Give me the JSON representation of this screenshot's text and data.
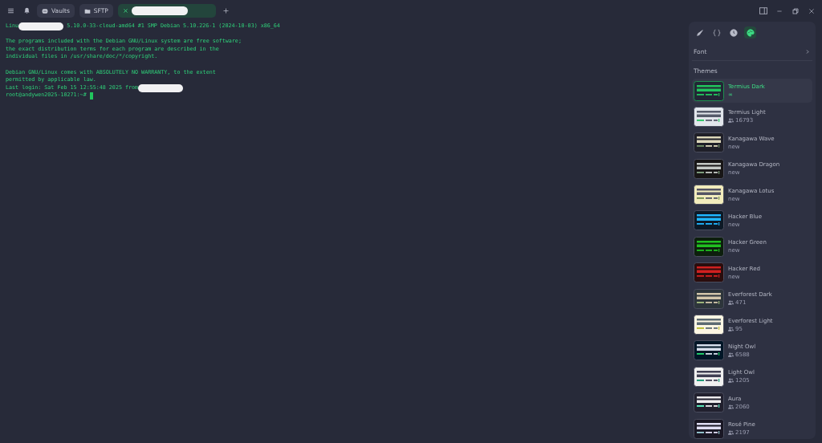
{
  "topbar": {
    "tabs": [
      {
        "label": "Vaults",
        "kind": "vault",
        "selected": false
      },
      {
        "label": "SFTP",
        "kind": "folder",
        "selected": false
      },
      {
        "kind": "session",
        "selected": true
      }
    ]
  },
  "terminal": {
    "lines": [
      {
        "parts": [
          {
            "kind": "text",
            "text": "Linu"
          },
          {
            "kind": "redaction"
          },
          {
            "kind": "text",
            "text": " 5.10.0-33-cloud-amd64 #1 SMP Debian 5.10.226-1 (2024-10-03) x86_64"
          }
        ]
      },
      {
        "kind": "blank"
      },
      {
        "parts": [
          {
            "kind": "text",
            "text": "The programs included with the Debian GNU/Linux system are free software;"
          }
        ]
      },
      {
        "parts": [
          {
            "kind": "text",
            "text": "the exact distribution terms for each program are described in the"
          }
        ]
      },
      {
        "parts": [
          {
            "kind": "text",
            "text": "individual files in /usr/share/doc/*/copyright."
          }
        ]
      },
      {
        "kind": "blank"
      },
      {
        "parts": [
          {
            "kind": "text",
            "text": "Debian GNU/Linux comes with ABSOLUTELY NO WARRANTY, to the extent"
          }
        ]
      },
      {
        "parts": [
          {
            "kind": "text",
            "text": "permitted by applicable law."
          }
        ]
      },
      {
        "parts": [
          {
            "kind": "text",
            "text": "Last login: Sat Feb 15 12:55:48 2025 from"
          },
          {
            "kind": "redaction"
          }
        ]
      },
      {
        "parts": [
          {
            "kind": "text",
            "text": "root@andywen2025-10271:~# "
          },
          {
            "kind": "cursor"
          }
        ]
      }
    ]
  },
  "panel": {
    "tools": [
      {
        "selected": false
      },
      {
        "selected": false
      },
      {
        "selected": false
      },
      {
        "selected": true
      }
    ],
    "font_label": "Font",
    "themes_heading": "Themes",
    "themes": [
      {
        "name": "Termius Dark",
        "selected": true,
        "kind": "infinity",
        "meta": "∞",
        "preview": [
          {
            "color": "#222635"
          },
          {
            "color": "#21c45d"
          },
          {
            "color": "#21c45d"
          }
        ]
      },
      {
        "name": "Termius Light",
        "selected": false,
        "kind": "users",
        "meta": "16793",
        "preview": [
          {
            "color": "#e2e6ec"
          },
          {
            "color": "#555a6a"
          },
          {
            "color": "#21c45d"
          }
        ]
      },
      {
        "name": "Kanagawa Wave",
        "selected": false,
        "kind": "new",
        "meta": "new",
        "preview": [
          {
            "color": "#1f1f28"
          },
          {
            "color": "#dcd7ba"
          },
          {
            "color": "#76946a"
          }
        ]
      },
      {
        "name": "Kanagawa Dragon",
        "selected": false,
        "kind": "new",
        "meta": "new",
        "preview": [
          {
            "color": "#181616"
          },
          {
            "color": "#c5c9c5"
          },
          {
            "color": "#87a987"
          }
        ]
      },
      {
        "name": "Kanagawa Lotus",
        "selected": false,
        "kind": "new",
        "meta": "new",
        "preview": [
          {
            "color": "#f2ecbc"
          },
          {
            "color": "#545464"
          },
          {
            "color": "#6f894e"
          }
        ]
      },
      {
        "name": "Hacker Blue",
        "selected": false,
        "kind": "new",
        "meta": "new",
        "preview": [
          {
            "color": "#0d1926"
          },
          {
            "color": "#1fb6ff"
          },
          {
            "color": "#1fb6ff"
          }
        ]
      },
      {
        "name": "Hacker Green",
        "selected": false,
        "kind": "new",
        "meta": "new",
        "preview": [
          {
            "color": "#0d1f0d"
          },
          {
            "color": "#20c020"
          },
          {
            "color": "#20c020"
          }
        ]
      },
      {
        "name": "Hacker Red",
        "selected": false,
        "kind": "new",
        "meta": "new",
        "preview": [
          {
            "color": "#2a0d0d"
          },
          {
            "color": "#d02020"
          },
          {
            "color": "#d02020"
          }
        ]
      },
      {
        "name": "Everforest Dark",
        "selected": false,
        "kind": "users",
        "meta": "471",
        "preview": [
          {
            "color": "#2d353b"
          },
          {
            "color": "#d3c6aa"
          },
          {
            "color": "#a7c080"
          }
        ]
      },
      {
        "name": "Everforest Light",
        "selected": false,
        "kind": "users",
        "meta": "95",
        "preview": [
          {
            "color": "#fdf6e3"
          },
          {
            "color": "#5c6a72"
          },
          {
            "color": "#b5b82a"
          }
        ]
      },
      {
        "name": "Night Owl",
        "selected": false,
        "kind": "users",
        "meta": "6588",
        "preview": [
          {
            "color": "#011627"
          },
          {
            "color": "#d6deeb"
          },
          {
            "color": "#22da6e"
          }
        ]
      },
      {
        "name": "Light Owl",
        "selected": false,
        "kind": "users",
        "meta": "1205",
        "preview": [
          {
            "color": "#f0f0f0"
          },
          {
            "color": "#403f53"
          },
          {
            "color": "#08916a"
          }
        ]
      },
      {
        "name": "Aura",
        "selected": false,
        "kind": "users",
        "meta": "2060",
        "preview": [
          {
            "color": "#21202e"
          },
          {
            "color": "#edecee"
          },
          {
            "color": "#61ffca"
          }
        ]
      },
      {
        "name": "Rosé Pine",
        "selected": false,
        "kind": "users",
        "meta": "2197",
        "preview": [
          {
            "color": "#191724"
          },
          {
            "color": "#e0def4"
          },
          {
            "color": "#9ccfd8"
          }
        ]
      }
    ]
  }
}
